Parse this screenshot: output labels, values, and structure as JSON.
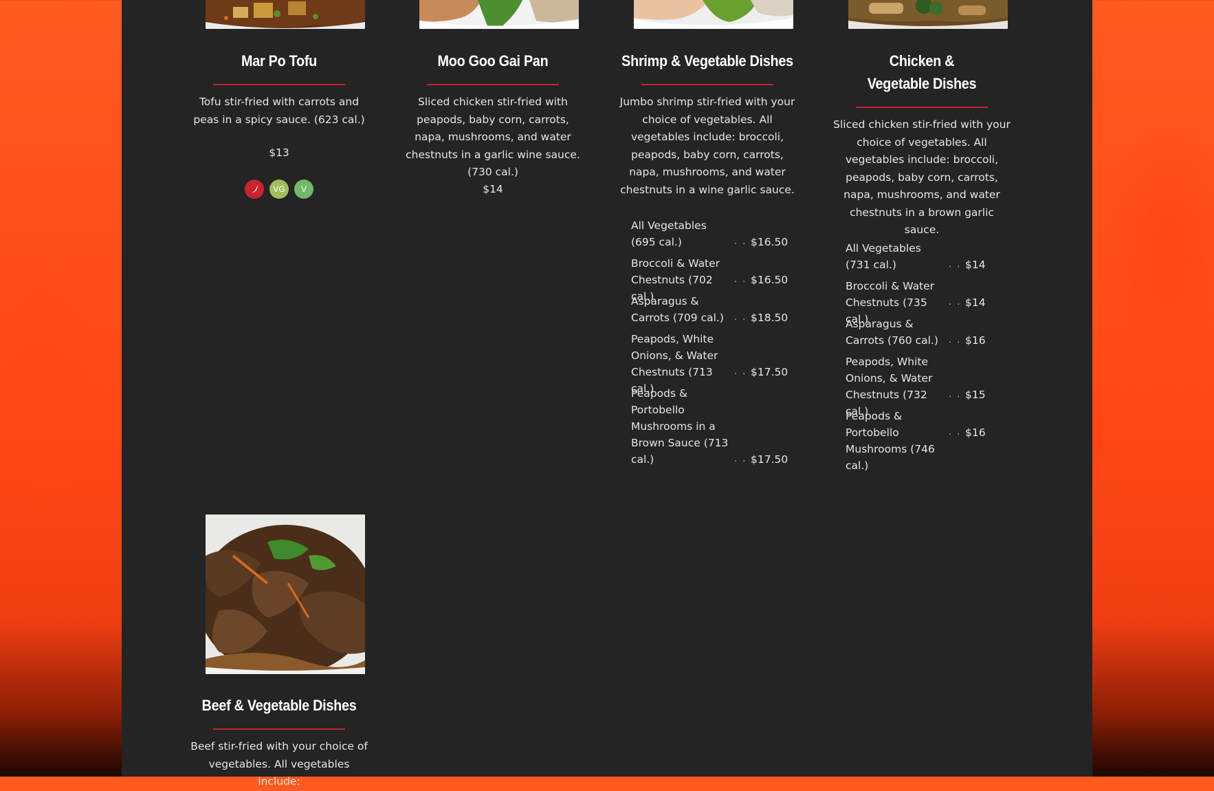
{
  "dishes": [
    {
      "name": "Mar Po Tofu",
      "description": "Tofu stir-fried with carrots and peas in a spicy sauce. (623 cal.)",
      "price": "$13",
      "badges": [
        {
          "type": "spicy",
          "icon": "chili-pepper-icon",
          "label": ""
        },
        {
          "type": "vegan",
          "icon": "vegan-badge",
          "label": "VG"
        },
        {
          "type": "vegetarian",
          "icon": "vegetarian-badge",
          "label": "V"
        }
      ]
    },
    {
      "name": "Moo Goo Gai Pan",
      "description": "Sliced chicken stir-fried with peapods, baby corn, carrots, napa, mushrooms, and water chestnuts in a garlic wine sauce. (730 cal.)",
      "price": "$14"
    },
    {
      "name": "Shrimp & Vegetable Dishes",
      "description": "Jumbo shrimp stir-fried with your choice of vegetables. All vegetables include: broccoli, peapods, baby corn, carrots, napa, mushrooms, and water chestnuts in a wine garlic sauce.",
      "options": [
        {
          "name": "All Vegetables (695 cal.)",
          "price": "$16.50"
        },
        {
          "name": "Broccoli & Water Chestnuts (702 cal.)",
          "price": "$16.50"
        },
        {
          "name": "Asparagus & Carrots (709 cal.)",
          "price": "$18.50"
        },
        {
          "name": "Peapods, White Onions, & Water Chestnuts (713 cal.)",
          "price": "$17.50"
        },
        {
          "name": "Peapods & Portobello Mushrooms in a Brown Sauce (713 cal.)",
          "price": "$17.50"
        }
      ]
    },
    {
      "name": "Chicken & Vegetable Dishes",
      "description": "Sliced chicken stir-fried with your choice of vegetables. All vegetables include: broccoli, peapods, baby corn, carrots, napa, mushrooms, and water chestnuts in a brown garlic sauce.",
      "options": [
        {
          "name": "All Vegetables (731 cal.)",
          "price": "$14"
        },
        {
          "name": "Broccoli & Water Chestnuts (735 cal.)",
          "price": "$14"
        },
        {
          "name": "Asparagus & Carrots (760 cal.)",
          "price": "$16"
        },
        {
          "name": "Peapods, White Onions, & Water Chestnuts (732 cal.)",
          "price": "$15"
        },
        {
          "name": "Peapods & Portobello Mushrooms (746 cal.)",
          "price": "$16"
        }
      ]
    },
    {
      "name": "Beef & Vegetable Dishes",
      "description": "Beef stir-fried with your choice of vegetables. All vegetables include:"
    }
  ],
  "option_leader": ". . .",
  "colors": {
    "background": "#ff4715",
    "panel": "#242424",
    "accent_rule": "#c8242f",
    "spicy_badge": "#c8242f",
    "vegan_badge": "#9fbf5a",
    "vegetarian_badge": "#71b86a"
  }
}
